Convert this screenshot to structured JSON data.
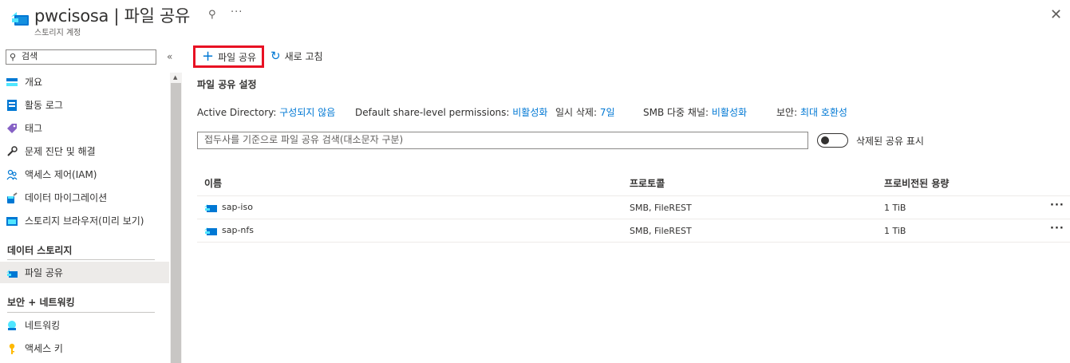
{
  "header": {
    "title": "pwcisosa | 파일 공유",
    "subtitle": "스토리지 계정",
    "pin_glyph": "⚲",
    "more_glyph": "···",
    "close_glyph": "✕"
  },
  "sidebar": {
    "search_placeholder": "검색",
    "collapse_glyph": "«",
    "items": [
      {
        "label": "개요",
        "icon": "overview-icon"
      },
      {
        "label": "활동 로그",
        "icon": "activity-log-icon"
      },
      {
        "label": "태그",
        "icon": "tag-icon"
      },
      {
        "label": "문제 진단 및 해결",
        "icon": "wrench-icon"
      },
      {
        "label": "액세스 제어(IAM)",
        "icon": "people-icon"
      },
      {
        "label": "데이터 마이그레이션",
        "icon": "migration-icon"
      },
      {
        "label": "스토리지 브라우저(미리 보기)",
        "icon": "storage-browser-icon"
      }
    ],
    "section_data_storage": "데이터 스토리지",
    "selected_item": {
      "label": "파일 공유",
      "icon": "file-share-icon"
    },
    "section_security": "보안 + 네트워킹",
    "items2": [
      {
        "label": "네트워킹",
        "icon": "networking-icon"
      },
      {
        "label": "액세스 키",
        "icon": "key-icon"
      }
    ]
  },
  "toolbar": {
    "add_label": "파일 공유",
    "refresh_label": "새로 고침"
  },
  "settings": {
    "title": "파일 공유 설정",
    "ad_key": "Active Directory:",
    "ad_value": "구성되지 않음",
    "perm_key": "Default share-level permissions:",
    "perm_value": "비활성화",
    "softdel_key": "일시 삭제:",
    "softdel_value": "7일",
    "smb_key": "SMB 다중 채널:",
    "smb_value": "비활성화",
    "sec_key": "보안:",
    "sec_value": "최대 호환성"
  },
  "filter": {
    "placeholder": "접두사를 기준으로 파일 공유 검색(대소문자 구분)",
    "toggle_label": "삭제된 공유 표시"
  },
  "table": {
    "columns": [
      "이름",
      "프로토콜",
      "프로비전된 용량"
    ],
    "rows": [
      {
        "name": "sap-iso",
        "protocol": "SMB, FileREST",
        "capacity": "1 TiB"
      },
      {
        "name": "sap-nfs",
        "protocol": "SMB, FileREST",
        "capacity": "1 TiB"
      }
    ],
    "more_glyph": "···"
  },
  "colors": {
    "accent": "#0078d4",
    "highlight_border": "#e81123"
  }
}
